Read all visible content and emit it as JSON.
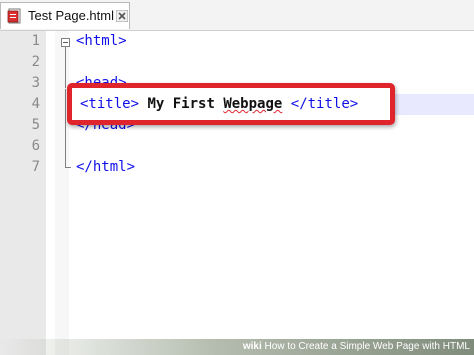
{
  "tab": {
    "label": "Test Page.html",
    "icon": "file-icon",
    "close_icon": "close-icon"
  },
  "editor": {
    "line_numbers": [
      "1",
      "2",
      "3",
      "4",
      "5",
      "6",
      "7"
    ],
    "lines": {
      "l1": "<html>",
      "l3": "<head>",
      "l5": "</head>",
      "l7": "</html>"
    },
    "callout": {
      "open_tag": "<title>",
      "text_a": " My First ",
      "text_b": "Webpage",
      "text_c": " ",
      "close_tag": "</title>"
    },
    "colors": {
      "tag": "#1010e8",
      "callout_border": "#e0242c",
      "current_line": "#e8e8ff"
    }
  },
  "watermark": {
    "brand": "wiki",
    "caption": "How to Create a Simple Web Page with HTML"
  }
}
